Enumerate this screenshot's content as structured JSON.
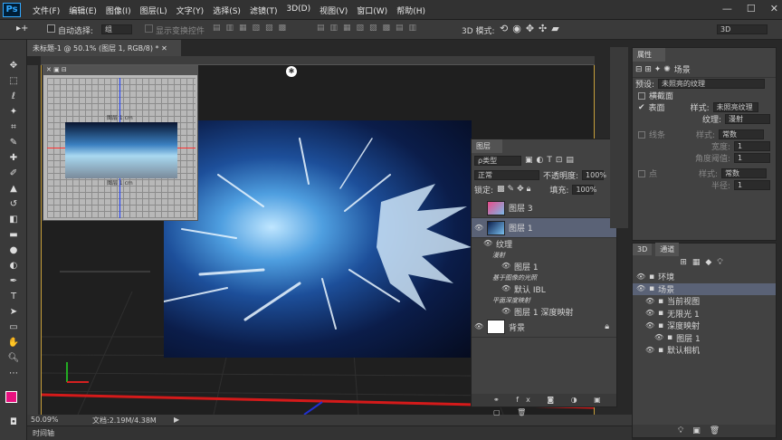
{
  "app": {
    "logo": "Ps"
  },
  "menu": [
    "文件(F)",
    "编辑(E)",
    "图像(I)",
    "图层(L)",
    "文字(Y)",
    "选择(S)",
    "滤镜(T)",
    "3D(D)",
    "视图(V)",
    "窗口(W)",
    "帮助(H)"
  ],
  "options": {
    "auto_select_label": "自动选择:",
    "auto_select_value": "组",
    "show_transform": "显示变换控件",
    "mode_3d": "3D 模式:",
    "workspace": "3D"
  },
  "document": {
    "tab": "未标题-1 @ 50.1% (图层 1, RGB/8) *",
    "zoom": "50.09%",
    "doc_size": "文档:2.19M/4.38M",
    "timeline": "时间轴"
  },
  "properties": {
    "title": "属性",
    "scene_label": "场景",
    "preset_label": "预设:",
    "preset_value": "未照亮的纹理",
    "cross_section": "横截面",
    "surface": "表面",
    "style_label": "样式:",
    "style_value": "未照亮纹理",
    "texture_label": "纹理:",
    "texture_value": "漫射",
    "lines": "线条",
    "lines_style": "常数",
    "width_label": "宽度:",
    "width_value": "1",
    "angle_label": "角度阈值:",
    "angle_value": "1",
    "points": "点",
    "points_style": "常数",
    "radius_label": "半径:",
    "radius_value": "1"
  },
  "layers": {
    "title": "图层",
    "kind": "ρ类型",
    "blend": "正常",
    "opacity_label": "不透明度:",
    "opacity": "100%",
    "lock_label": "锁定:",
    "fill_label": "填充:",
    "fill": "100%",
    "items": [
      {
        "name": "图层 3",
        "indent": 0
      },
      {
        "name": "图层 1",
        "indent": 0
      },
      {
        "name": "纹理",
        "indent": 1
      },
      {
        "name": "漫射",
        "indent": 2
      },
      {
        "name": "图层 1",
        "indent": 3
      },
      {
        "name": "基于图像的光照",
        "indent": 2
      },
      {
        "name": "默认 IBL",
        "indent": 3
      },
      {
        "name": "平面深度映射",
        "indent": 2
      },
      {
        "name": "图层 1 深度映射",
        "indent": 3
      },
      {
        "name": "背景",
        "indent": 0
      }
    ]
  },
  "panel3d": {
    "tabs": [
      "3D",
      "通道"
    ],
    "items": [
      "环境",
      "场景",
      "当前视图",
      "无限光 1",
      "深度映射",
      "图层 1",
      "默认相机"
    ]
  },
  "colors": {
    "accent": "#31a8ff",
    "foreground": "#e8117f",
    "guide": "#ff2020"
  },
  "thumbnail": {
    "top_label": "图层 1 cm",
    "bottom_label": "图层 1 cm"
  }
}
